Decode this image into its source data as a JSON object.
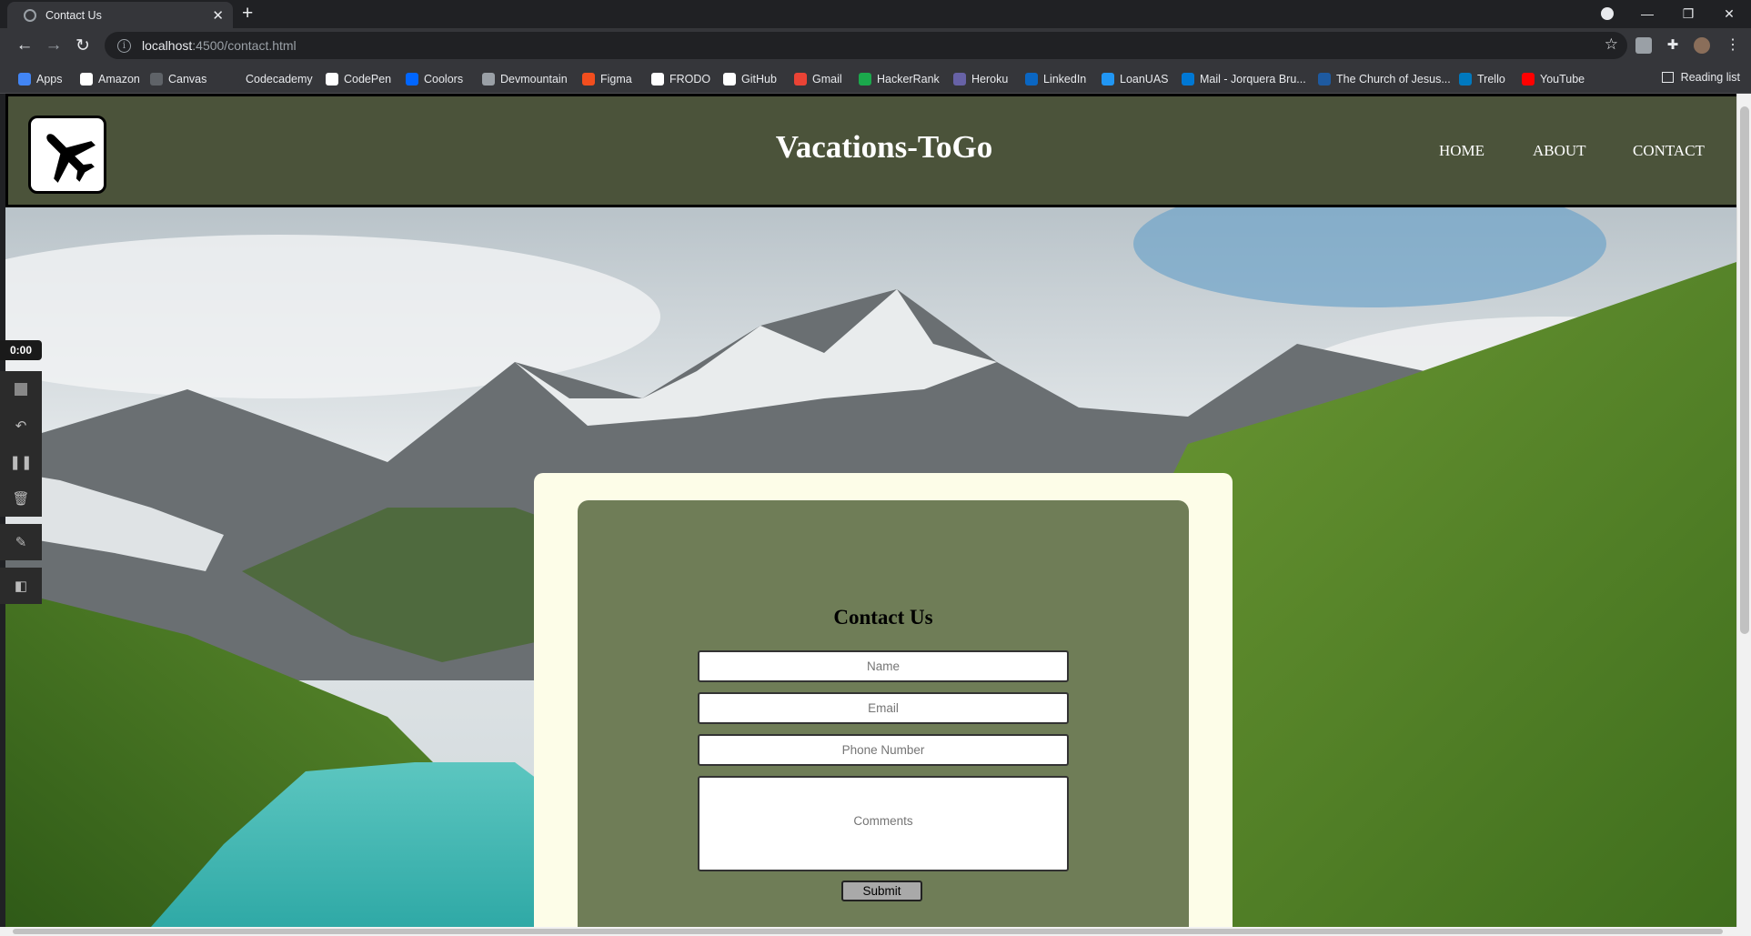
{
  "browser": {
    "tab_title": "Contact Us",
    "url_host": "localhost",
    "url_path": ":4500/contact.html",
    "bookmarks": [
      {
        "label": "Apps",
        "color": "#4285f4"
      },
      {
        "label": "Amazon",
        "color": "#ffffff"
      },
      {
        "label": "Canvas",
        "color": "#5f6368"
      },
      {
        "label": "Codecademy",
        "color": "#35363a"
      },
      {
        "label": "CodePen",
        "color": "#ffffff"
      },
      {
        "label": "Coolors",
        "color": "#0066ff"
      },
      {
        "label": "Devmountain",
        "color": "#9aa0a6"
      },
      {
        "label": "Figma",
        "color": "#f24e1e"
      },
      {
        "label": "FRODO",
        "color": "#ffffff"
      },
      {
        "label": "GitHub",
        "color": "#ffffff"
      },
      {
        "label": "Gmail",
        "color": "#ea4335"
      },
      {
        "label": "HackerRank",
        "color": "#1ba94c"
      },
      {
        "label": "Heroku",
        "color": "#6762a6"
      },
      {
        "label": "LinkedIn",
        "color": "#0a66c2"
      },
      {
        "label": "LoanUAS",
        "color": "#2196f3"
      },
      {
        "label": "Mail - Jorquera Bru...",
        "color": "#0078d4"
      },
      {
        "label": "The Church of Jesus...",
        "color": "#1e5aa0"
      },
      {
        "label": "Trello",
        "color": "#0079bf"
      },
      {
        "label": "YouTube",
        "color": "#ff0000"
      }
    ],
    "reading_list": "Reading list"
  },
  "site": {
    "title": "Vacations-ToGo",
    "nav": [
      "HOME",
      "ABOUT",
      "CONTACT"
    ],
    "logo_icon": "airplane-icon"
  },
  "form": {
    "heading": "Contact Us",
    "name_placeholder": "Name",
    "email_placeholder": "Email",
    "phone_placeholder": "Phone Number",
    "comments_placeholder": "Comments",
    "submit_label": "Submit"
  },
  "recorder": {
    "time": "0:00"
  }
}
